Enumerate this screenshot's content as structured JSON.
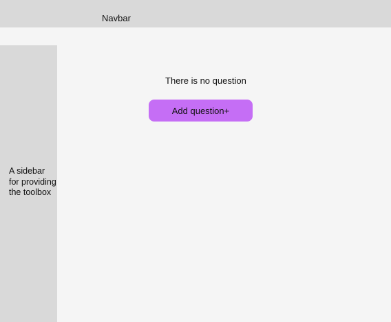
{
  "navbar": {
    "label": "Navbar"
  },
  "sidebar": {
    "text": "A sidebar\nfor providing\nthe toolbox"
  },
  "main": {
    "empty_message": "There is no question",
    "add_button_label": "Add question+"
  },
  "colors": {
    "background": "#f5f5f5",
    "panel_gray": "#d9d9d9",
    "accent_purple": "#c56ef5"
  }
}
